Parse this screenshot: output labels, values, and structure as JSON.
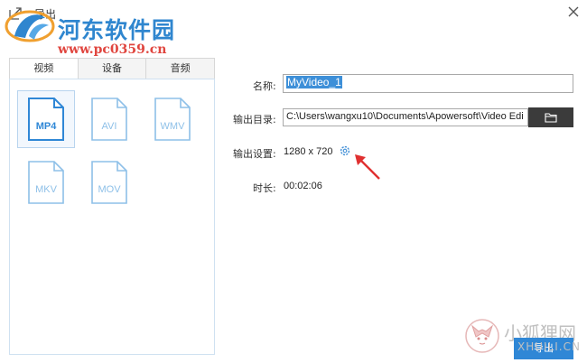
{
  "window": {
    "title": "导出"
  },
  "watermark": {
    "site_name": "河东软件园",
    "site_url": "www.pc0359.cn",
    "corner_name": "小狐狸网",
    "corner_url": "XHUILI.CN"
  },
  "tabs": [
    {
      "label": "视频",
      "active": true
    },
    {
      "label": "设备",
      "active": false
    },
    {
      "label": "音频",
      "active": false
    }
  ],
  "formats": [
    {
      "label": "MP4",
      "selected": true
    },
    {
      "label": "AVI",
      "selected": false
    },
    {
      "label": "WMV",
      "selected": false
    },
    {
      "label": "MKV",
      "selected": false
    },
    {
      "label": "MOV",
      "selected": false
    }
  ],
  "form": {
    "name_label": "名称:",
    "name_value": "MyVideo_1",
    "dir_label": "输出目录:",
    "dir_value": "C:\\Users\\wangxu10\\Documents\\Apowersoft\\Video Edi",
    "settings_label": "输出设置:",
    "settings_value": "1280 x 720",
    "duration_label": "时长:",
    "duration_value": "00:02:06"
  },
  "buttons": {
    "export_label": "导出"
  },
  "colors": {
    "accent": "#2f87d6",
    "format_icon": "#8ec0e8",
    "format_icon_selected": "#2f87d6",
    "folder_button": "#3b3b3b",
    "annotation_arrow": "#e03030"
  }
}
